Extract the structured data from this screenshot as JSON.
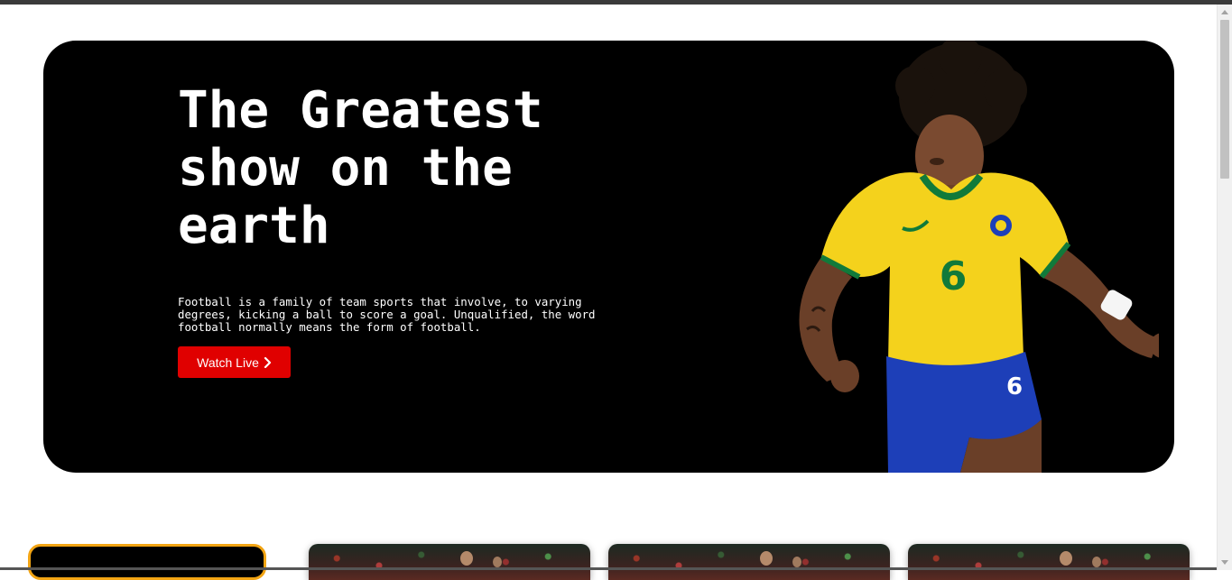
{
  "hero": {
    "title": "The Greatest show on the earth",
    "description": "Football is a family of team sports that involve, to varying degrees, kicking a ball to score a goal. Unqualified, the word football normally means the form of football.",
    "cta_label": "Watch Live",
    "cta_icon": "chevron-right-icon",
    "player_image": "football-player-image",
    "player_jersey_number": "6"
  },
  "colors": {
    "hero_bg": "#000000",
    "cta_bg": "#e00000",
    "jersey_yellow": "#f4d21c",
    "shorts_blue": "#1d3fb8",
    "featured_border": "#f2a413"
  },
  "cards": [
    {
      "kind": "featured"
    },
    {
      "kind": "match-thumbnail"
    },
    {
      "kind": "match-thumbnail"
    },
    {
      "kind": "match-thumbnail"
    }
  ]
}
